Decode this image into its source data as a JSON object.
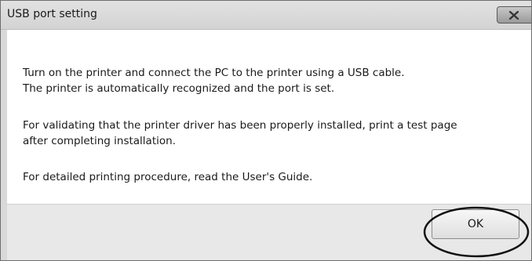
{
  "window": {
    "title": "USB port setting"
  },
  "message": {
    "line1": "Turn on the printer and connect the PC to the printer using a USB cable.",
    "line2": "The printer is automatically recognized and the port is set.",
    "line3": "For validating that the printer driver has been properly installed, print a test page",
    "line4": "after completing installation.",
    "line5": "For detailed printing procedure, read the User's Guide."
  },
  "buttons": {
    "ok_label": "OK"
  },
  "icons": {
    "close": "close-icon"
  },
  "colors": {
    "titlebar": "#d6d6d6",
    "content_bg": "#ffffff",
    "footer_bg": "#e8e8e8",
    "highlight_ring": "#111111"
  }
}
